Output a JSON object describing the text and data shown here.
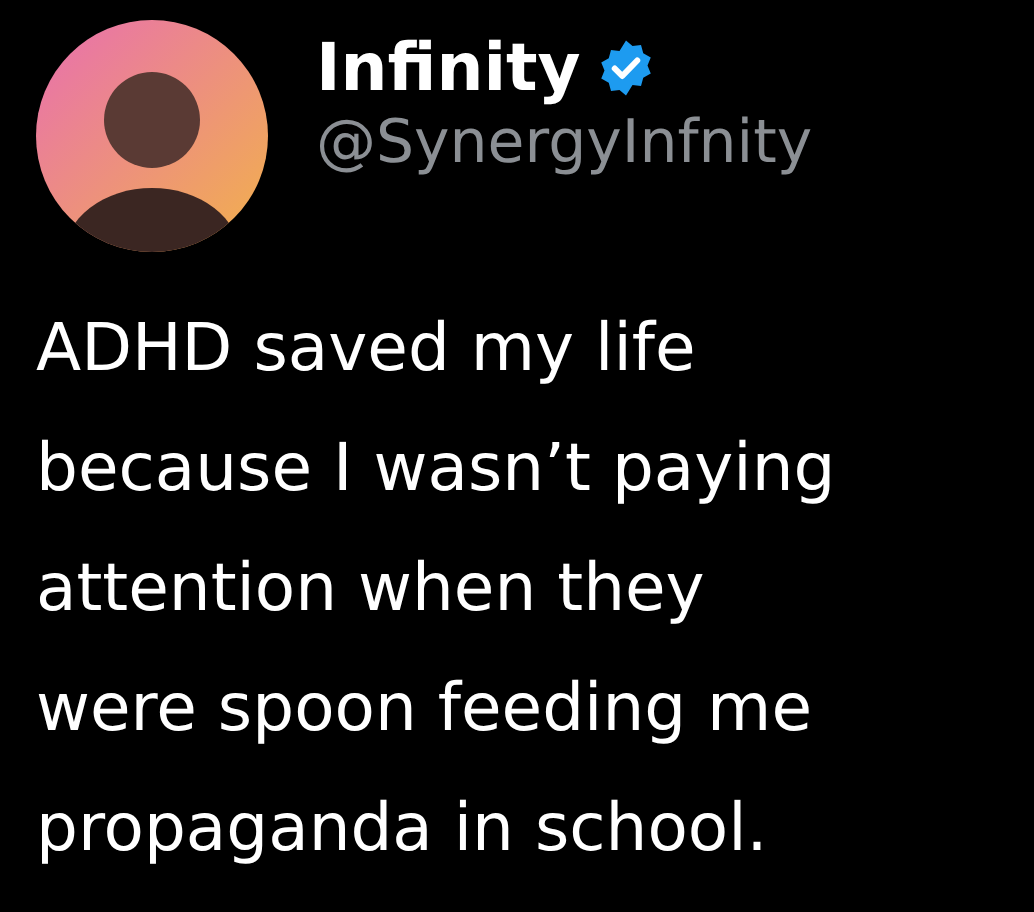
{
  "author": {
    "name": "Infinity",
    "verified": true,
    "handle": "@SynergyInfnity"
  },
  "text": "ADHD saved my life\nbecause I wasn’t paying\nattention when they\nwere spoon feeding me\npropaganda in school."
}
